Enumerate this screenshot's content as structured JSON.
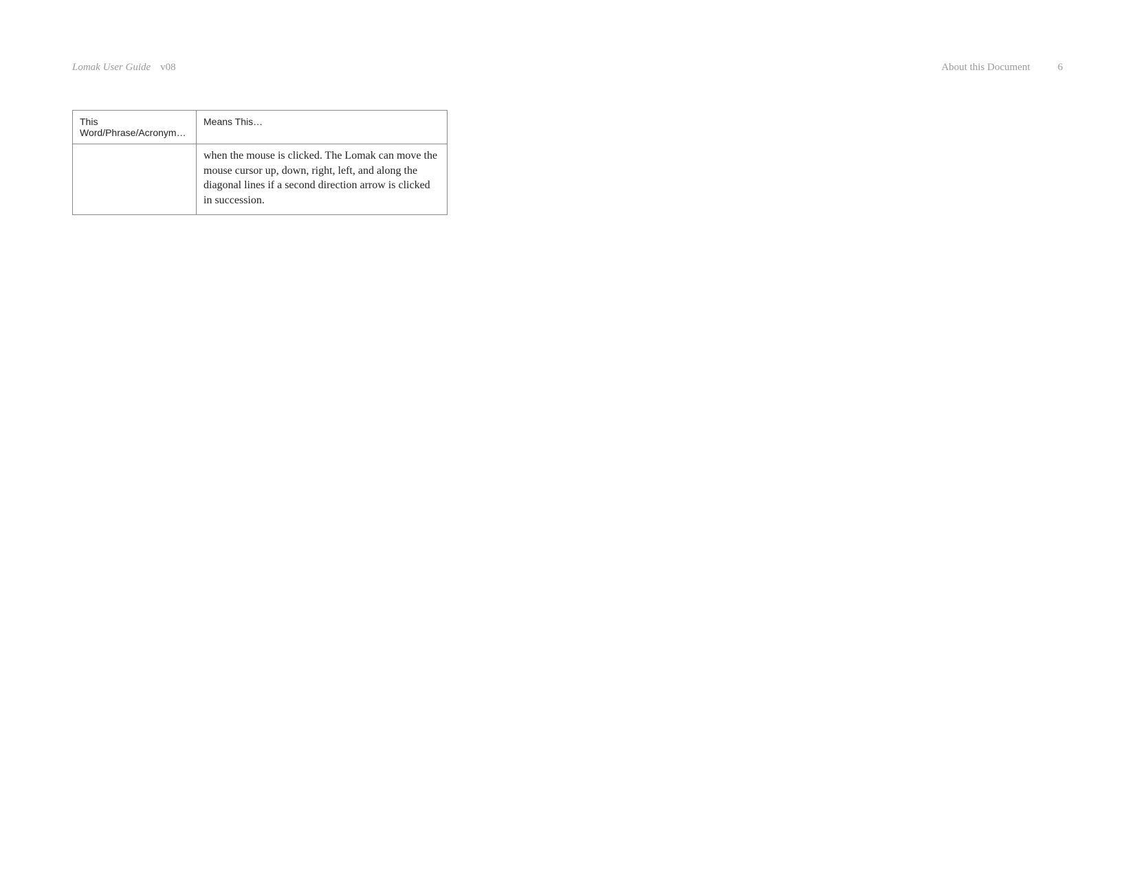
{
  "header": {
    "title": "Lomak User Guide",
    "version": "v08",
    "section": "About this Document",
    "page": "6"
  },
  "table": {
    "headers": {
      "col1": "This Word/Phrase/Acronym…",
      "col2": "Means This…"
    },
    "rows": [
      {
        "col1": "",
        "col2": "when the mouse is clicked. The Lomak can move the mouse cursor up, down, right, left, and along the diagonal lines if a second direction arrow is clicked in succession."
      }
    ]
  }
}
